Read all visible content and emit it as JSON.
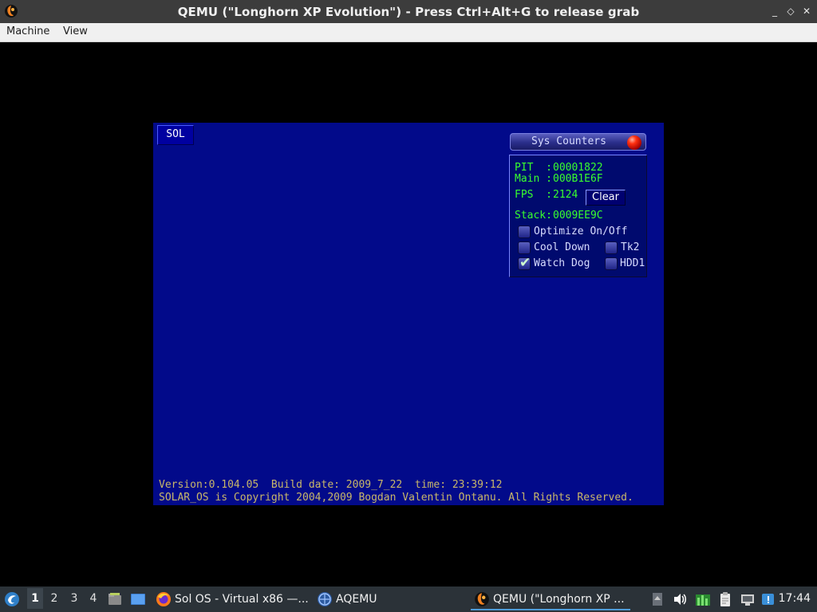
{
  "window": {
    "title": "QEMU (\"Longhorn XP Evolution\") - Press Ctrl+Alt+G to release grab",
    "app_icon": "qemu-icon",
    "buttons": {
      "minimize": "_",
      "restore": "◇",
      "close": "✕"
    }
  },
  "menubar": {
    "items": [
      "Machine",
      "View"
    ]
  },
  "guest": {
    "tab_label": "SOL",
    "panel": {
      "title": "Sys Counters",
      "pit_label": "PIT  :",
      "pit_value": "00001822",
      "main_label": "Main :",
      "main_value": "000B1E6F",
      "fps_label": "FPS  :",
      "fps_value": "2124",
      "clear_label": "Clear",
      "stack_label": "Stack:",
      "stack_value": "0009EE9C",
      "options": [
        {
          "label": "Optimize On/Off",
          "checked": false
        },
        {
          "label": "Cool Down",
          "checked": false
        },
        {
          "label": "Watch Dog",
          "checked": true
        },
        {
          "label": "Tk2",
          "checked": false
        },
        {
          "label": "HDD1",
          "checked": false
        }
      ]
    },
    "version_line": "Version:0.104.05  Build date: 2009_7_22  time: 23:39:12",
    "copyright_line": "SOLAR_OS is Copyright 2004,2009 Bogdan Valentin Ontanu. All Rights Reserved."
  },
  "taskbar": {
    "workspaces": [
      "1",
      "2",
      "3",
      "4"
    ],
    "active_workspace": "1",
    "tasks": [
      {
        "label": "Sol OS - Virtual x86 —...",
        "icon": "firefox-icon"
      },
      {
        "label": "AQEMU",
        "icon": "aqemu-icon"
      },
      {
        "label": "QEMU (\"Longhorn XP ...",
        "icon": "qemu-icon"
      }
    ],
    "clock": "17:44"
  },
  "colors": {
    "guest_bg": "#020a8a",
    "counter_text": "#39ff2e",
    "version_text": "#c9b76a",
    "taskbar_bg": "#2b3238"
  }
}
